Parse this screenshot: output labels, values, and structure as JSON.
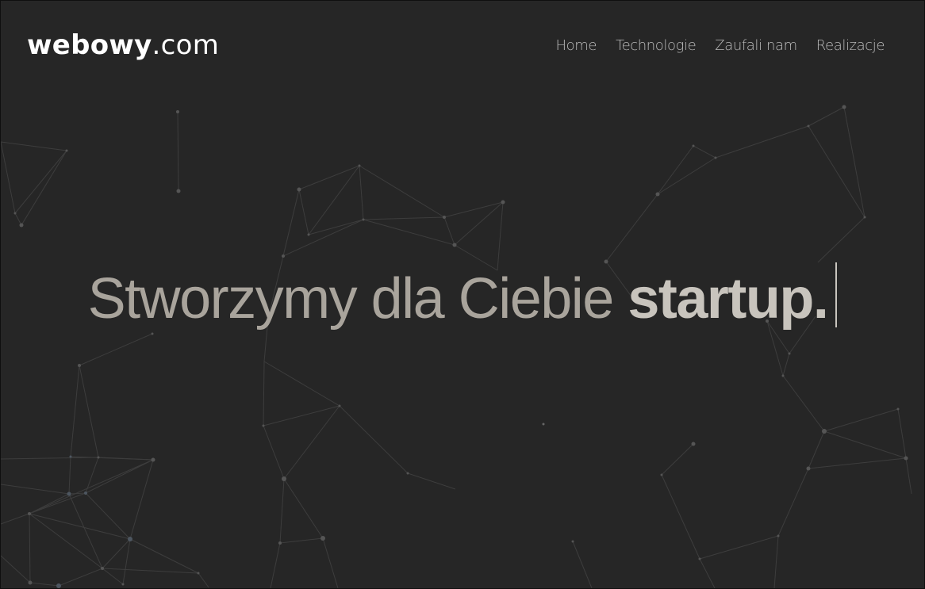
{
  "brand": {
    "logo_strong": "webowy",
    "logo_light": ".com"
  },
  "nav": {
    "items": [
      {
        "label": "Home"
      },
      {
        "label": "Technologie"
      },
      {
        "label": "Zaufali nam"
      },
      {
        "label": "Realizacje"
      }
    ]
  },
  "hero": {
    "text_plain": "Stworzymy dla Ciebie ",
    "text_emphasis": "startup."
  },
  "colors": {
    "background": "#262626",
    "nav_text": "#b9b9b9",
    "headline": "#a9a49c",
    "headline_emphasis": "#c8c4bd",
    "network_lines": "#3d3d3d"
  }
}
